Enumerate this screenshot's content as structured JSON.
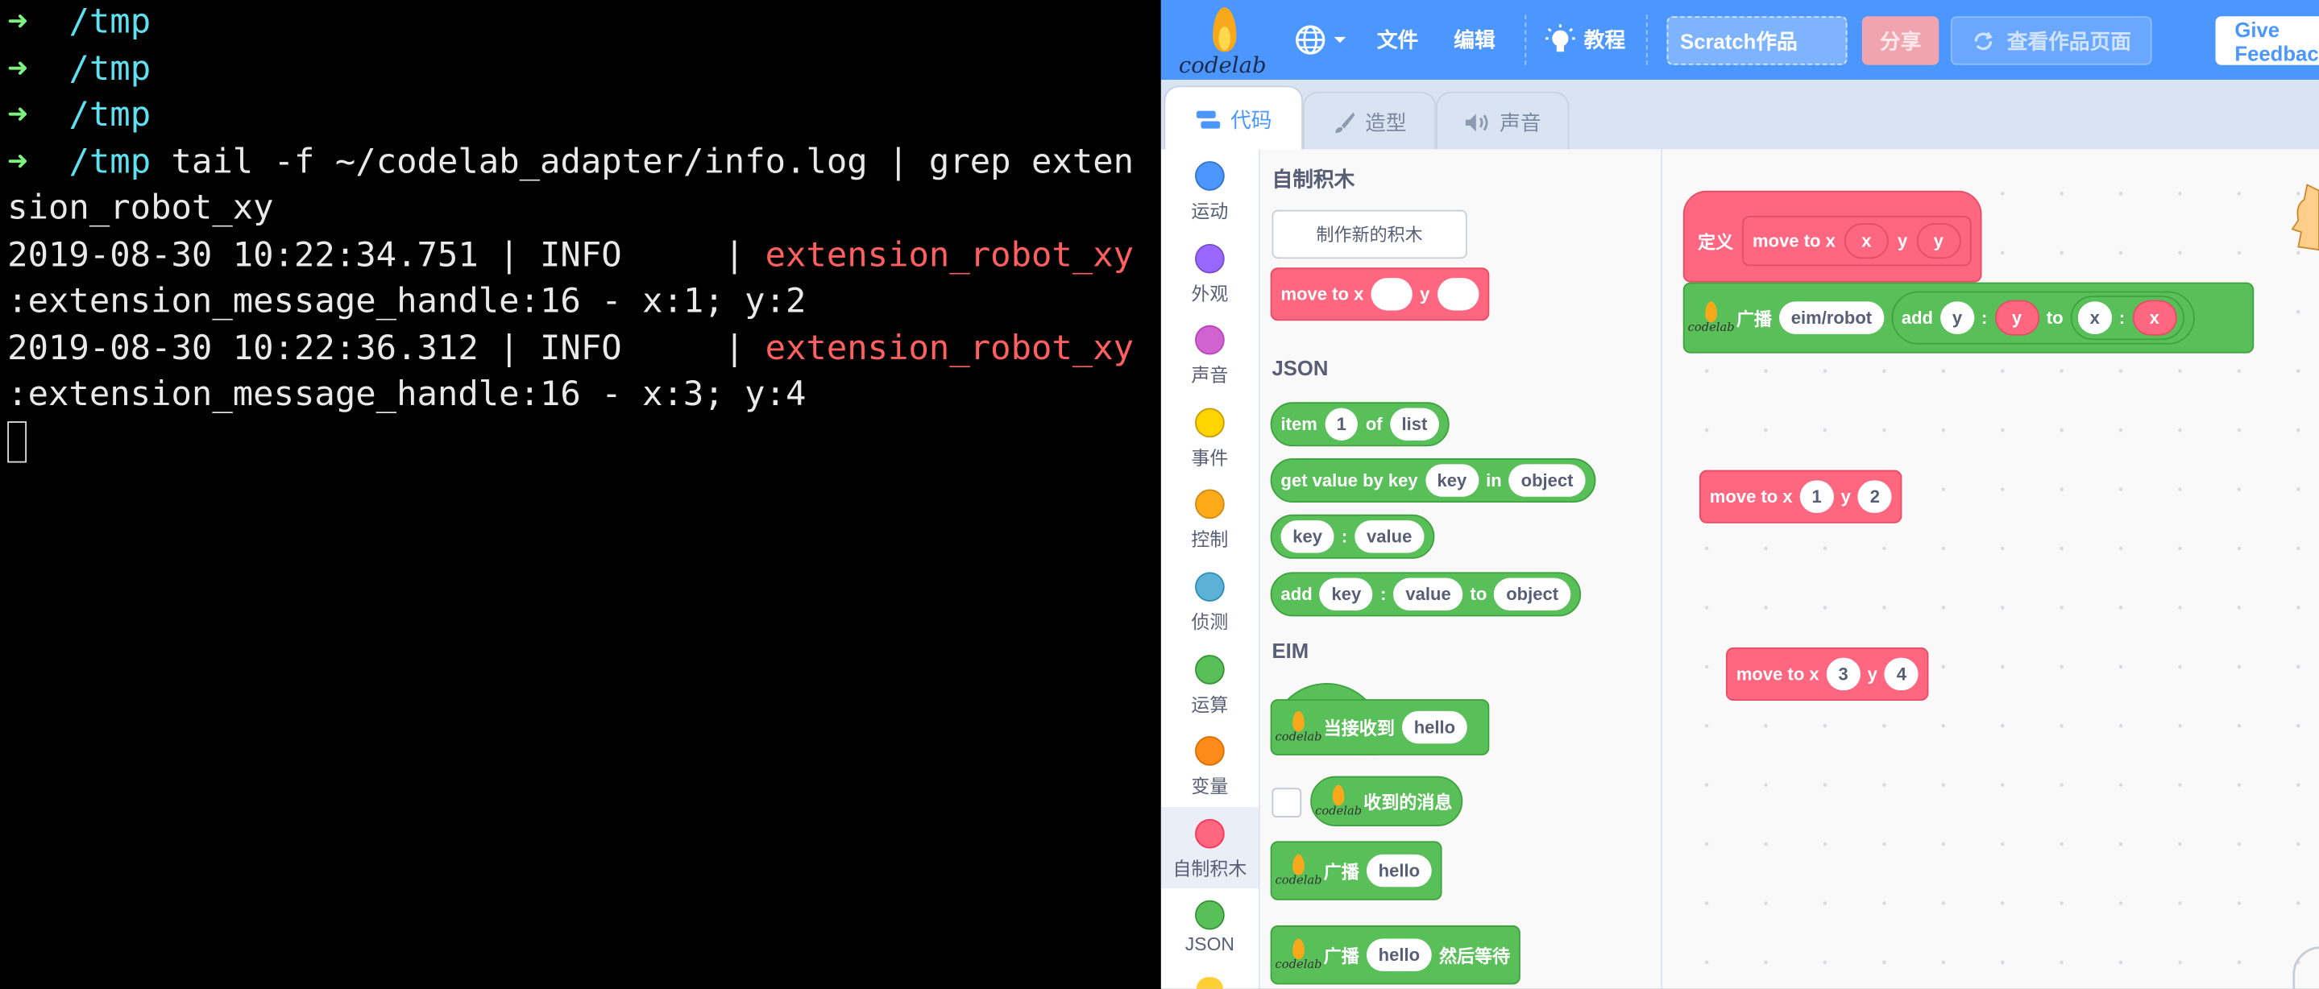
{
  "terminal": {
    "prompt_arrow": "➜",
    "lines": [
      {
        "path": "/tmp",
        "cmd": ""
      },
      {
        "path": "/tmp",
        "cmd": ""
      },
      {
        "path": "/tmp",
        "cmd": ""
      },
      {
        "path": "/tmp",
        "cmd": " tail -f ~/codelab_adapter/info.log | grep exten"
      }
    ],
    "wrap1": "sion_robot_xy",
    "log": [
      {
        "time": "2019-08-30 10:22:34.751 | INFO     | ",
        "module": "extension_robot_xy",
        "cont": ":extension_message_handle:16 - x:1; y:2"
      },
      {
        "time": "2019-08-30 10:22:36.312 | INFO     | ",
        "module": "extension_robot_xy",
        "cont": ":extension_message_handle:16 - x:3; y:4"
      }
    ]
  },
  "menubar": {
    "logo_text": "codelab",
    "file": "文件",
    "edit": "编辑",
    "tutorial": "教程",
    "project_title": "Scratch作品",
    "share": "分享",
    "see_project": "查看作品页面",
    "feedback": "Give Feedback"
  },
  "tabs": {
    "code": "代码",
    "costumes": "造型",
    "sounds": "声音"
  },
  "categories": [
    {
      "label": "运动",
      "color": "#4c97ff"
    },
    {
      "label": "外观",
      "color": "#9966ff"
    },
    {
      "label": "声音",
      "color": "#cf63cf"
    },
    {
      "label": "事件",
      "color": "#ffd500"
    },
    {
      "label": "控制",
      "color": "#ffab19"
    },
    {
      "label": "侦测",
      "color": "#5cb1d6"
    },
    {
      "label": "运算",
      "color": "#59c059"
    },
    {
      "label": "变量",
      "color": "#ff8c1a"
    },
    {
      "label": "自制积木",
      "color": "#ff6680"
    },
    {
      "label": "JSON",
      "color": "#59c059"
    }
  ],
  "palette": {
    "my_blocks_title": "自制积木",
    "make_block": "制作新的积木",
    "move_block": {
      "t1": "move to x",
      "t2": "y"
    },
    "json_title": "JSON",
    "item_block": {
      "t1": "item",
      "v1": "1",
      "t2": "of",
      "v2": "list"
    },
    "getvalue_block": {
      "t1": "get value by key",
      "v1": "key",
      "t2": "in",
      "v2": "object"
    },
    "kv_block": {
      "v1": "key",
      "t1": ":",
      "v2": "value"
    },
    "add_block": {
      "t1": "add",
      "v1": "key",
      "t2": ":",
      "v2": "value",
      "t3": "to",
      "v3": "object"
    },
    "eim_title": "EIM",
    "when_receive": {
      "t1": "当接收到",
      "v1": "hello"
    },
    "received_msg": "收到的消息",
    "broadcast": {
      "t1": "广播",
      "v1": "hello"
    },
    "broadcast_wait": {
      "t1": "广播",
      "v1": "hello",
      "t2": "然后等待"
    }
  },
  "workspace": {
    "define": {
      "t0": "定义",
      "t1": "move to x",
      "p1": "x",
      "t2": "y",
      "p2": "y"
    },
    "broadcast": {
      "t1": "广播",
      "v1": "eim/robot",
      "t2": "add",
      "v2": "y",
      "t3": ":",
      "p3": "y",
      "t4": "to",
      "v4": "x",
      "t5": ":",
      "p5": "x"
    },
    "call1": {
      "t1": "move to x",
      "v1": "1",
      "t2": "y",
      "v2": "2"
    },
    "call2": {
      "t1": "move to x",
      "v1": "3",
      "t2": "y",
      "v2": "4"
    }
  }
}
